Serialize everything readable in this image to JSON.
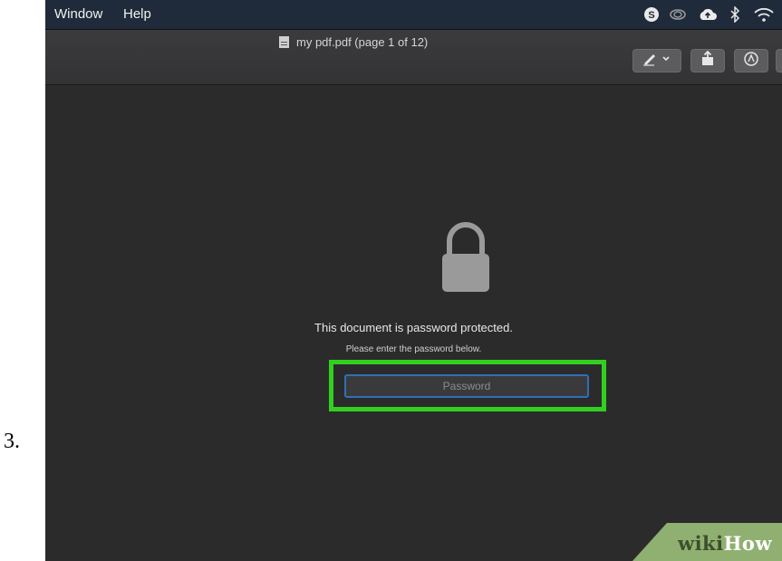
{
  "step": {
    "number": "3."
  },
  "menubar": {
    "items": [
      "Window",
      "Help"
    ],
    "status_icons": [
      "skype-icon",
      "creative-cloud-icon",
      "cloud-upload-icon",
      "bluetooth-icon",
      "wifi-icon"
    ]
  },
  "titlebar": {
    "title": "my pdf.pdf (page 1 of 12)",
    "toolbar": [
      "markup-pen-icon",
      "share-icon",
      "annotate-icon"
    ]
  },
  "document": {
    "message": "This document is password protected.",
    "instruction": "Please enter the password below."
  },
  "password": {
    "placeholder": "Password",
    "value": ""
  },
  "highlight": {
    "color": "#31d01f"
  },
  "watermark": {
    "prefix": "wiki",
    "suffix": "How"
  },
  "colors": {
    "menubar": "#1f2a3a",
    "window": "#2b2b2c",
    "focus_ring": "#2f6fb5"
  }
}
